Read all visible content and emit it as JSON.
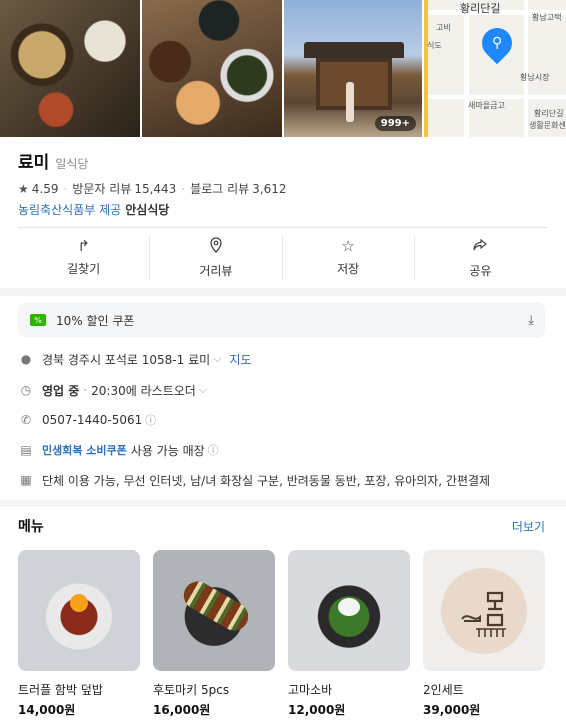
{
  "photos": {
    "count_badge": "999+",
    "map_labels": [
      "황리단길",
      "황남고택",
      "식도",
      "고비",
      "황남시장",
      "새마을금고",
      "황리단길",
      "생활문화센"
    ]
  },
  "place": {
    "name": "료미",
    "category": "일식당",
    "rating": "4.59",
    "visitor_review_label": "방문자 리뷰",
    "visitor_review_count": "15,443",
    "blog_review_label": "블로그 리뷰",
    "blog_review_count": "3,612",
    "provider_text": "농림축산식품부 제공",
    "provider_brand": "안심식당"
  },
  "actions": [
    {
      "label": "길찾기",
      "icon": "directions-icon"
    },
    {
      "label": "거리뷰",
      "icon": "location-pin-icon"
    },
    {
      "label": "저장",
      "icon": "star-icon"
    },
    {
      "label": "공유",
      "icon": "share-icon"
    }
  ],
  "coupon": {
    "label": "10% 할인 쿠폰",
    "icon_text": "%"
  },
  "info": {
    "address": "경북 경주시 포석로 1058-1 료미",
    "address_link": "지도",
    "hours_status": "영업 중",
    "hours_detail": "20:30에 라스트오더",
    "phone": "0507-1440-5061",
    "voucher_brand": "민생회복 소비쿠폰",
    "voucher_text": "사용 가능 매장",
    "amenities": "단체 이용 가능, 무선 인터넷, 남/녀 화장실 구분, 반려동물 동반, 포장, 유아의자, 간편결제"
  },
  "menu": {
    "title": "메뉴",
    "more": "더보기",
    "items": [
      {
        "name": "트러플 함박 덮밥",
        "price": "14,000원"
      },
      {
        "name": "후토마키 5pcs",
        "price": "16,000원"
      },
      {
        "name": "고마소바",
        "price": "12,000원"
      },
      {
        "name": "2인세트",
        "price": "39,000원"
      }
    ]
  },
  "colors": {
    "link": "#2d6fb8",
    "coupon_green": "#2db400",
    "map_pin": "#1e88ff"
  }
}
